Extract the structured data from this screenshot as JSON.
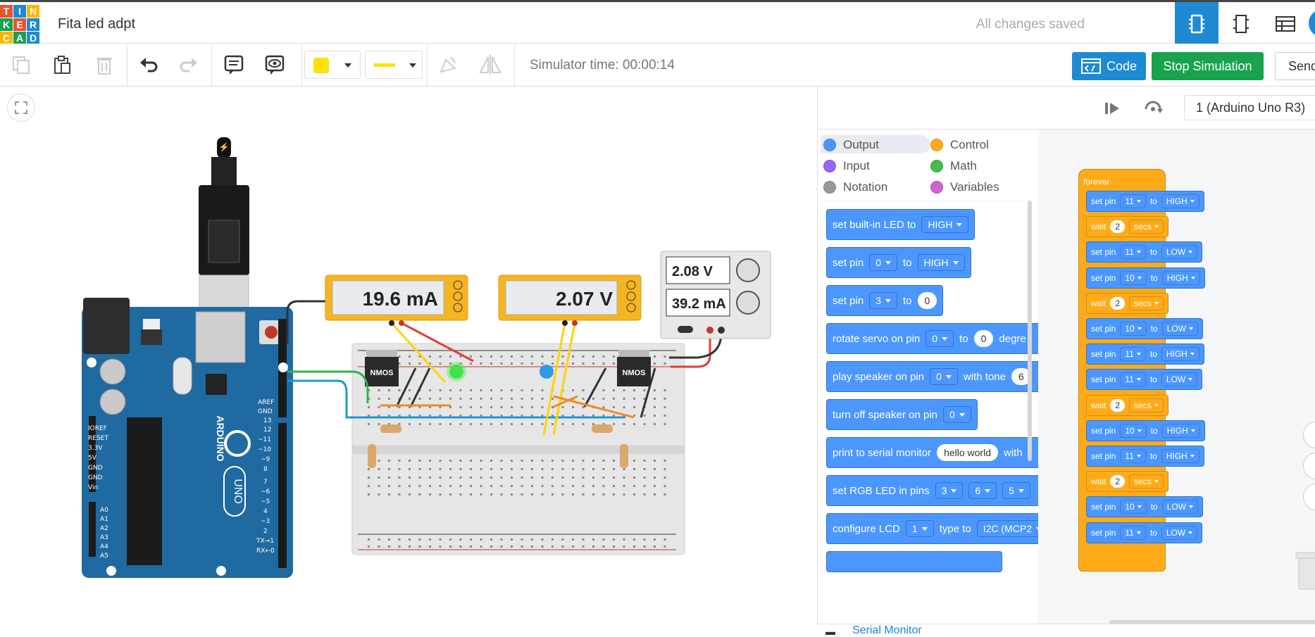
{
  "app": {
    "logo_letters": [
      "T",
      "I",
      "N",
      "K",
      "E",
      "R",
      "C",
      "A",
      "D"
    ],
    "logo_colors": [
      "#e8532f",
      "#1d8ad3",
      "#ffb400",
      "#18a34d",
      "#e8532f",
      "#1d8ad3",
      "#ffb400",
      "#18a34d",
      "#1d8ad3"
    ],
    "project_title": "Fita led adpt",
    "save_status": "All changes saved",
    "view_icons": [
      "circuit-view-icon",
      "schematic-view-icon",
      "component-list-icon"
    ]
  },
  "toolbar": {
    "simulator_time": "Simulator time: 00:00:14",
    "code_label": "Code",
    "stop_label": "Stop Simulation",
    "send_label": "Send",
    "fill_color": "#ffe000",
    "wire_color": "#ffe000"
  },
  "canvas": {
    "meter1": "19.6 mA",
    "meter2": "2.07 V",
    "psu_voltage": "2.08 V",
    "psu_current": "39.2 mA",
    "nmos1": "NMOS",
    "nmos2": "NMOS",
    "board_text": "ARDUINO",
    "board_model": "UNO"
  },
  "code_panel": {
    "device": "1 (Arduino Uno R3)",
    "categories": [
      {
        "label": "Output",
        "color": "#4c97ff"
      },
      {
        "label": "Control",
        "color": "#ffab19"
      },
      {
        "label": "Input",
        "color": "#9966ff"
      },
      {
        "label": "Math",
        "color": "#40bf4a"
      },
      {
        "label": "Notation",
        "color": "#999999"
      },
      {
        "label": "Variables",
        "color": "#cf63cf"
      }
    ],
    "palette": {
      "b1_text": "set built-in LED to",
      "b1_val": "HIGH",
      "b2_text": "set pin",
      "b2_pin": "0",
      "b2_to": "to",
      "b2_val": "HIGH",
      "b3_text": "set pin",
      "b3_pin": "3",
      "b3_to": "to",
      "b3_val": "0",
      "b4_text": "rotate servo on pin",
      "b4_pin": "0",
      "b4_to": "to",
      "b4_val": "0",
      "b4_tail": "degre",
      "b5_text": "play speaker on pin",
      "b5_pin": "0",
      "b5_tone": "with tone",
      "b5_val": "6",
      "b6_text": "turn off speaker on pin",
      "b6_pin": "0",
      "b7_text": "print to serial monitor",
      "b7_val": "hello world",
      "b7_with": "with",
      "b8_text": "set RGB LED in pins",
      "b8_p1": "3",
      "b8_p2": "6",
      "b8_p3": "5",
      "b9_text": "configure LCD",
      "b9_val": "1",
      "b9_type": "type to",
      "b9_type_val": "I2C (MCP2"
    },
    "program": {
      "hat": "forever",
      "set_pin": "set pin",
      "to": "to",
      "wait": "wait",
      "secs": "secs",
      "steps": [
        {
          "type": "set",
          "pin": "11",
          "val": "HIGH"
        },
        {
          "type": "wait",
          "val": "2"
        },
        {
          "type": "set",
          "pin": "11",
          "val": "LOW"
        },
        {
          "type": "set",
          "pin": "10",
          "val": "HIGH"
        },
        {
          "type": "wait",
          "val": "2"
        },
        {
          "type": "set",
          "pin": "10",
          "val": "LOW"
        },
        {
          "type": "set",
          "pin": "11",
          "val": "HIGH"
        },
        {
          "type": "set",
          "pin": "11",
          "val": "LOW"
        },
        {
          "type": "wait",
          "val": "2"
        },
        {
          "type": "set",
          "pin": "10",
          "val": "HIGH"
        },
        {
          "type": "set",
          "pin": "11",
          "val": "HIGH"
        },
        {
          "type": "wait",
          "val": "2"
        },
        {
          "type": "set",
          "pin": "10",
          "val": "LOW"
        },
        {
          "type": "set",
          "pin": "11",
          "val": "LOW"
        }
      ]
    },
    "serial_monitor": "Serial Monitor"
  }
}
